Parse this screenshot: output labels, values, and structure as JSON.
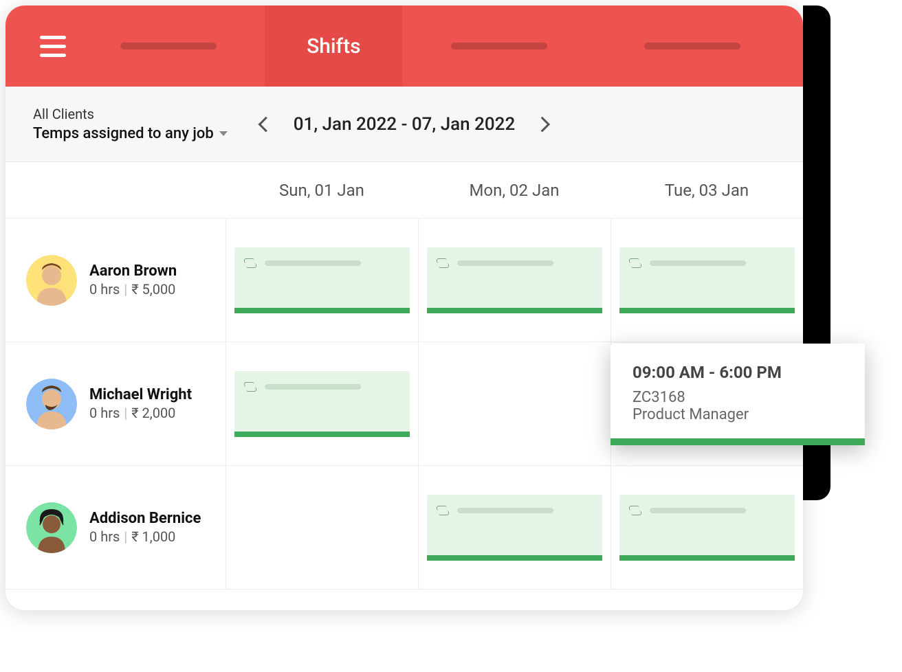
{
  "header": {
    "active_tab": "Shifts"
  },
  "filter": {
    "clients_label": "All Clients",
    "temps_label": "Temps assigned to any job",
    "date_range": "01, Jan 2022 - 07, Jan 2022"
  },
  "days": [
    {
      "label": "Sun, 01 Jan"
    },
    {
      "label": "Mon, 02 Jan"
    },
    {
      "label": "Tue, 03 Jan"
    }
  ],
  "people": [
    {
      "name": "Aaron Brown",
      "hours": "0 hrs",
      "amount": "₹ 5,000",
      "avatar_bg": "#ffe17a",
      "shifts": [
        true,
        true,
        true
      ]
    },
    {
      "name": "Michael Wright",
      "hours": "0 hrs",
      "amount": "₹ 2,000",
      "avatar_bg": "#8fbdf6",
      "shifts": [
        true,
        false,
        false
      ]
    },
    {
      "name": "Addison Bernice",
      "hours": "0 hrs",
      "amount": "₹ 1,000",
      "avatar_bg": "#7be3a3",
      "shifts": [
        false,
        true,
        true
      ]
    }
  ],
  "popover": {
    "time": "09:00 AM - 6:00 PM",
    "code": "ZC3168",
    "role": "Product Manager"
  }
}
